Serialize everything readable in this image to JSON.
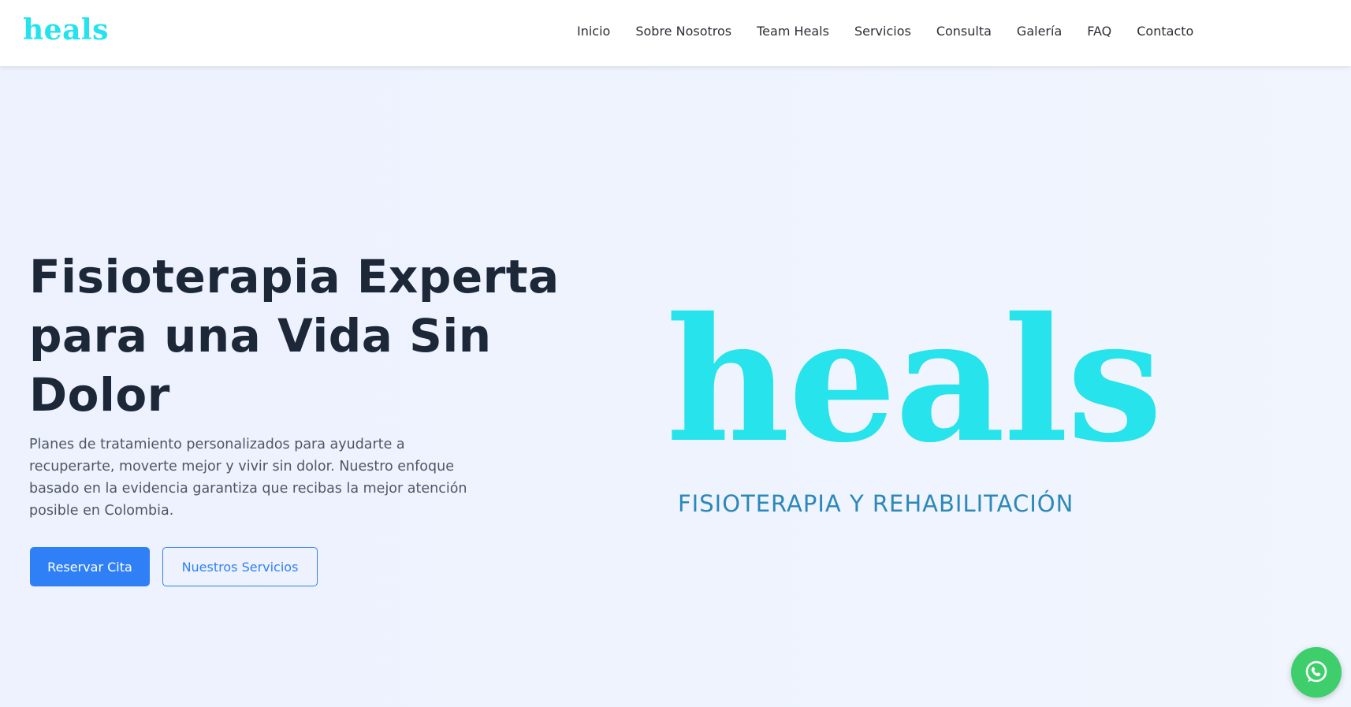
{
  "header": {
    "brand": "heals",
    "nav": [
      "Inicio",
      "Sobre Nosotros",
      "Team Heals",
      "Servicios",
      "Consulta",
      "Galería",
      "FAQ",
      "Contacto"
    ]
  },
  "hero": {
    "title": "Fisioterapia Experta para una Vida Sin Dolor",
    "description": "Planes de tratamiento personalizados para ayudarte a recuperarte, moverte mejor y vivir sin dolor. Nuestro enfoque basado en la evidencia garantiza que recibas la mejor atención posible en Colombia.",
    "primary_button": "Reservar Cita",
    "secondary_button": "Nuestros Servicios",
    "logo_word": "heals",
    "logo_tagline": "FISIOTERAPIA Y REHABILITACIÓN"
  },
  "floating": {
    "icon": "whatsapp-icon"
  },
  "colors": {
    "brand_cyan": "#22e3ee",
    "primary_blue": "#2f80f6",
    "heading": "#1c2738",
    "tagline": "#2b88b8",
    "whatsapp_green": "#3ecf6c"
  }
}
